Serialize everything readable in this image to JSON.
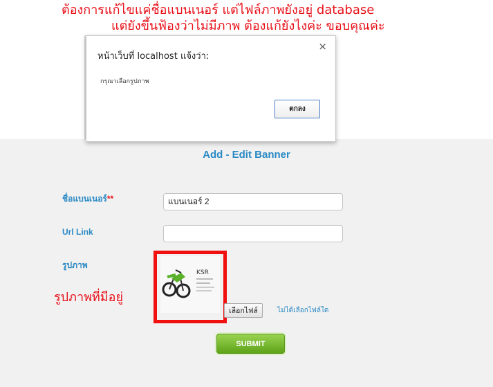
{
  "annotations": {
    "top_line1": "ต้องการแก้ไขแค่ชื่อแบนเนอร์ แต่ไฟล์ภาพยังอยู่ database",
    "top_line2": "แต่ยังขึ้นฟ้องว่าไม่มีภาพ ต้องแก้ยังไงค่ะ ขอบคุณค่ะ",
    "existing_image": "รูปภาพที่มีอยู่",
    "color": "#e8121a"
  },
  "dialog": {
    "title": "หน้าเว็บที่ localhost แจ้งว่า:",
    "message": "กรุณาเลือกรูปภาพ",
    "ok_label": "ตกลง",
    "close_glyph": "×",
    "close_icon": "close-icon"
  },
  "form": {
    "title": "Add - Edit Banner",
    "banner_name_label": "ชื่อแบนเนอร์",
    "required_mark": "**",
    "banner_name_value": "แบนเนอร์ 2",
    "url_label": "Url Link",
    "url_value": "",
    "image_label": "รูปภาพ",
    "image_alt": "KSR",
    "choose_file_label": "เลือกไฟล์",
    "no_file_label": "ไม่ได้เลือกไฟล์ใด",
    "submit_label": "SUBMIT",
    "accent_color": "#2a89c4",
    "submit_color": "#6fb326"
  }
}
